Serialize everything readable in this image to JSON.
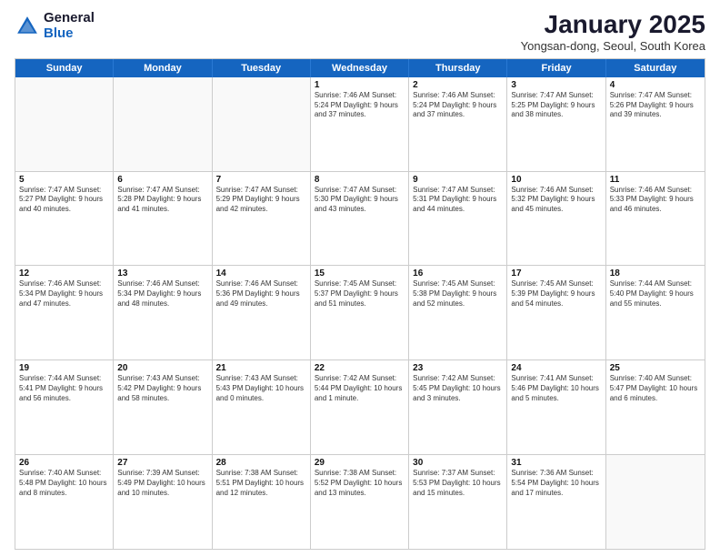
{
  "header": {
    "logo": {
      "general": "General",
      "blue": "Blue"
    },
    "title": "January 2025",
    "location": "Yongsan-dong, Seoul, South Korea"
  },
  "weekdays": [
    "Sunday",
    "Monday",
    "Tuesday",
    "Wednesday",
    "Thursday",
    "Friday",
    "Saturday"
  ],
  "rows": [
    [
      {
        "day": "",
        "text": ""
      },
      {
        "day": "",
        "text": ""
      },
      {
        "day": "",
        "text": ""
      },
      {
        "day": "1",
        "text": "Sunrise: 7:46 AM\nSunset: 5:24 PM\nDaylight: 9 hours and 37 minutes."
      },
      {
        "day": "2",
        "text": "Sunrise: 7:46 AM\nSunset: 5:24 PM\nDaylight: 9 hours and 37 minutes."
      },
      {
        "day": "3",
        "text": "Sunrise: 7:47 AM\nSunset: 5:25 PM\nDaylight: 9 hours and 38 minutes."
      },
      {
        "day": "4",
        "text": "Sunrise: 7:47 AM\nSunset: 5:26 PM\nDaylight: 9 hours and 39 minutes."
      }
    ],
    [
      {
        "day": "5",
        "text": "Sunrise: 7:47 AM\nSunset: 5:27 PM\nDaylight: 9 hours and 40 minutes."
      },
      {
        "day": "6",
        "text": "Sunrise: 7:47 AM\nSunset: 5:28 PM\nDaylight: 9 hours and 41 minutes."
      },
      {
        "day": "7",
        "text": "Sunrise: 7:47 AM\nSunset: 5:29 PM\nDaylight: 9 hours and 42 minutes."
      },
      {
        "day": "8",
        "text": "Sunrise: 7:47 AM\nSunset: 5:30 PM\nDaylight: 9 hours and 43 minutes."
      },
      {
        "day": "9",
        "text": "Sunrise: 7:47 AM\nSunset: 5:31 PM\nDaylight: 9 hours and 44 minutes."
      },
      {
        "day": "10",
        "text": "Sunrise: 7:46 AM\nSunset: 5:32 PM\nDaylight: 9 hours and 45 minutes."
      },
      {
        "day": "11",
        "text": "Sunrise: 7:46 AM\nSunset: 5:33 PM\nDaylight: 9 hours and 46 minutes."
      }
    ],
    [
      {
        "day": "12",
        "text": "Sunrise: 7:46 AM\nSunset: 5:34 PM\nDaylight: 9 hours and 47 minutes."
      },
      {
        "day": "13",
        "text": "Sunrise: 7:46 AM\nSunset: 5:34 PM\nDaylight: 9 hours and 48 minutes."
      },
      {
        "day": "14",
        "text": "Sunrise: 7:46 AM\nSunset: 5:36 PM\nDaylight: 9 hours and 49 minutes."
      },
      {
        "day": "15",
        "text": "Sunrise: 7:45 AM\nSunset: 5:37 PM\nDaylight: 9 hours and 51 minutes."
      },
      {
        "day": "16",
        "text": "Sunrise: 7:45 AM\nSunset: 5:38 PM\nDaylight: 9 hours and 52 minutes."
      },
      {
        "day": "17",
        "text": "Sunrise: 7:45 AM\nSunset: 5:39 PM\nDaylight: 9 hours and 54 minutes."
      },
      {
        "day": "18",
        "text": "Sunrise: 7:44 AM\nSunset: 5:40 PM\nDaylight: 9 hours and 55 minutes."
      }
    ],
    [
      {
        "day": "19",
        "text": "Sunrise: 7:44 AM\nSunset: 5:41 PM\nDaylight: 9 hours and 56 minutes."
      },
      {
        "day": "20",
        "text": "Sunrise: 7:43 AM\nSunset: 5:42 PM\nDaylight: 9 hours and 58 minutes."
      },
      {
        "day": "21",
        "text": "Sunrise: 7:43 AM\nSunset: 5:43 PM\nDaylight: 10 hours and 0 minutes."
      },
      {
        "day": "22",
        "text": "Sunrise: 7:42 AM\nSunset: 5:44 PM\nDaylight: 10 hours and 1 minute."
      },
      {
        "day": "23",
        "text": "Sunrise: 7:42 AM\nSunset: 5:45 PM\nDaylight: 10 hours and 3 minutes."
      },
      {
        "day": "24",
        "text": "Sunrise: 7:41 AM\nSunset: 5:46 PM\nDaylight: 10 hours and 5 minutes."
      },
      {
        "day": "25",
        "text": "Sunrise: 7:40 AM\nSunset: 5:47 PM\nDaylight: 10 hours and 6 minutes."
      }
    ],
    [
      {
        "day": "26",
        "text": "Sunrise: 7:40 AM\nSunset: 5:48 PM\nDaylight: 10 hours and 8 minutes."
      },
      {
        "day": "27",
        "text": "Sunrise: 7:39 AM\nSunset: 5:49 PM\nDaylight: 10 hours and 10 minutes."
      },
      {
        "day": "28",
        "text": "Sunrise: 7:38 AM\nSunset: 5:51 PM\nDaylight: 10 hours and 12 minutes."
      },
      {
        "day": "29",
        "text": "Sunrise: 7:38 AM\nSunset: 5:52 PM\nDaylight: 10 hours and 13 minutes."
      },
      {
        "day": "30",
        "text": "Sunrise: 7:37 AM\nSunset: 5:53 PM\nDaylight: 10 hours and 15 minutes."
      },
      {
        "day": "31",
        "text": "Sunrise: 7:36 AM\nSunset: 5:54 PM\nDaylight: 10 hours and 17 minutes."
      },
      {
        "day": "",
        "text": ""
      }
    ]
  ]
}
